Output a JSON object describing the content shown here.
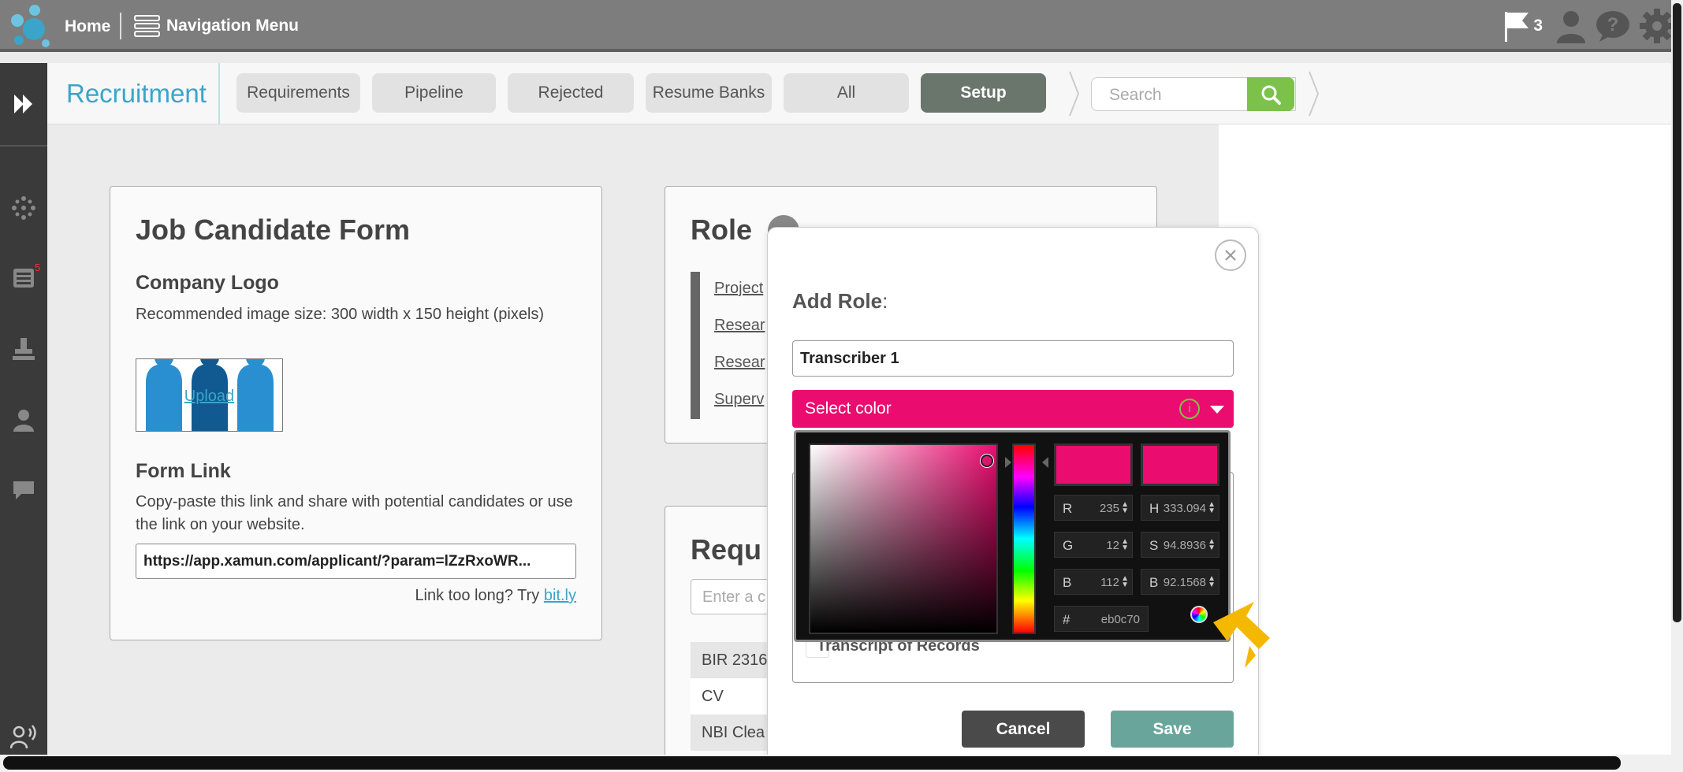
{
  "topbar": {
    "home_label": "Home",
    "nav_menu_label": "Navigation Menu",
    "notification_count": "3"
  },
  "sidebar": {
    "badge_count": "5"
  },
  "subheader": {
    "module_title": "Recruitment",
    "tabs": [
      {
        "label": "Requirements",
        "active": false
      },
      {
        "label": "Pipeline",
        "active": false
      },
      {
        "label": "Rejected",
        "active": false
      },
      {
        "label": "Resume Banks",
        "active": false
      },
      {
        "label": "All",
        "active": false
      },
      {
        "label": "Setup",
        "active": true
      }
    ],
    "search_placeholder": "Search"
  },
  "job_form": {
    "title": "Job Candidate Form",
    "logo_heading": "Company Logo",
    "logo_hint": "Recommended image size: 300 width x 150 height (pixels)",
    "upload_label": "Upload",
    "link_heading": "Form Link",
    "link_hint": "Copy-paste this link and share with potential candidates or use the link on your website.",
    "link_value": "https://app.xamun.com/applicant/?param=lZzRxoWR...",
    "too_long_text": "Link too long? Try",
    "bitly_label": "bit.ly"
  },
  "role_panel": {
    "title": "Role",
    "items": [
      "Project",
      "Resear",
      "Resear",
      "Superv"
    ]
  },
  "req_panel": {
    "title": "Requ",
    "input_placeholder": "Enter a c",
    "rows": [
      "BIR 2316",
      "CV",
      "NBI Clea"
    ]
  },
  "modal": {
    "title": "Add Role",
    "title_suffix": ":",
    "role_name_value": "Transcriber 1",
    "color_select_label": "Select color",
    "info_glyph": "i",
    "transcript_label": "Transcript of Records",
    "cancel_label": "Cancel",
    "save_label": "Save"
  },
  "color_picker": {
    "selected_hex": "#eb0c70",
    "r_label": "R",
    "r_value": "235",
    "g_label": "G",
    "g_value": "12",
    "b_label": "B",
    "b_value": "112",
    "h_label": "H",
    "h_value": "333.094",
    "s_label": "S",
    "s_value": "94.8936",
    "bv_label": "B",
    "bv_value": "92.1568",
    "hash_label": "#",
    "hex_value": "eb0c70"
  },
  "colors": {
    "accent_blue": "#3aa5c9",
    "search_green": "#7cc14a",
    "setup_tab": "#6a756b",
    "save_teal": "#6aa59b",
    "pointer_yellow": "#f5b800"
  }
}
